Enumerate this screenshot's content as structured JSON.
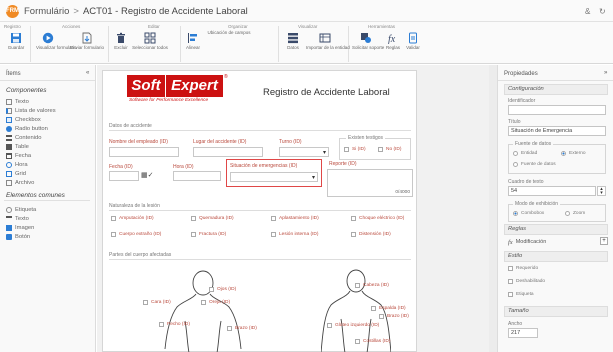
{
  "window": {
    "badge": "FRM",
    "breadcrumb_root": "Formulário",
    "breadcrumb_sep": ">",
    "breadcrumb_current": "ACT01 - Registro de Accidente Laboral",
    "flag": "&",
    "refresh_glyph": "↻"
  },
  "ribbon": {
    "groups": [
      "Registro",
      "Acciones",
      "Editar",
      "Organizar",
      "Visualizar",
      "Herramientas"
    ],
    "buttons": [
      {
        "label": "Guardar",
        "icon": "save-icon"
      },
      {
        "label": "Visualizar formulario",
        "icon": "preview-icon"
      },
      {
        "label": "Enviar formulario",
        "icon": "send-icon"
      },
      {
        "label": "Excluir",
        "icon": "delete-icon"
      },
      {
        "label": "Seleccionar todos",
        "icon": "select-all-icon"
      },
      {
        "label": "Alinear",
        "icon": "align-icon"
      },
      {
        "label": "Ubicación de campos",
        "icon": "field-location-icon"
      },
      {
        "label": "Datos",
        "icon": "data-icon"
      },
      {
        "label": "Importar de la entidad",
        "icon": "import-icon"
      },
      {
        "label": "Solicitar soporte",
        "icon": "support-icon"
      },
      {
        "label": "Reglas",
        "icon": "formula-icon"
      },
      {
        "label": "Validar",
        "icon": "validate-icon"
      }
    ]
  },
  "left_panel": {
    "title": "Ítems",
    "collapse_glyph": "«",
    "section_components": "Componentes",
    "components": [
      {
        "label": "Texto",
        "icon": "text-icon"
      },
      {
        "label": "Lista de valores",
        "icon": "list-icon"
      },
      {
        "label": "Checkbox",
        "icon": "checkbox-icon"
      },
      {
        "label": "Radio button",
        "icon": "radio-icon"
      },
      {
        "label": "Contenido",
        "icon": "content-icon"
      },
      {
        "label": "Table",
        "icon": "table-icon"
      },
      {
        "label": "Fecha",
        "icon": "date-icon"
      },
      {
        "label": "Hora",
        "icon": "clock-icon"
      },
      {
        "label": "Grid",
        "icon": "grid-icon"
      },
      {
        "label": "Archivo",
        "icon": "attachment-icon"
      }
    ],
    "section_elements": "Elementos comunes",
    "elements": [
      {
        "label": "Etiqueta",
        "icon": "label-icon"
      },
      {
        "label": "Texto",
        "icon": "textbox-icon"
      },
      {
        "label": "Imagen",
        "icon": "image-icon"
      },
      {
        "label": "Botón",
        "icon": "button-icon"
      }
    ]
  },
  "form": {
    "logo_soft": "Soft",
    "logo_expert": "Expert",
    "logo_reg": "®",
    "logo_tagline": "Software for Performance Excellence",
    "title": "Registro de Accidente Laboral",
    "section_employee": "Datos de accidente",
    "field_employee_name": "Nombre del empleado (ID)",
    "field_accident_place": "Lugar del accidente (ID)",
    "field_shift": "Turno (ID)",
    "group_witness": "Existen testigos",
    "witness_yes": "Si (ID)",
    "witness_no": "No (ID)",
    "field_date": "Fecha (ID)",
    "field_time": "Hora (ID)",
    "field_situation": "Situación de emergencias (ID)",
    "field_report": "Reporte (ID)",
    "char_counter": "0/4000",
    "section_nature": "Naturaleza de la lesión",
    "nature_options": [
      [
        "Amputación (ID)",
        "Quemadura (ID)",
        "Aplastamiento (ID)",
        "Choque eléctrico (ID)"
      ],
      [
        "Cuerpo extraño (ID)",
        "Fractura (ID)",
        "Lesión interna (ID)",
        "Distensión (ID)"
      ]
    ],
    "section_body": "Partes del cuerpo afectadas",
    "body_left_labels": [
      "Ojos (ID)",
      "Cara (ID)",
      "Oreja (ID)",
      "Pecho (ID)",
      "Brazo (ID)"
    ],
    "body_right_labels": [
      "Cabeza (ID)",
      "Espalda (ID)",
      "Brazo (ID)",
      "Glúteo izquierdo (ID)",
      "Costillas (ID)"
    ]
  },
  "right_panel": {
    "title": "Propiedades",
    "collapse_glyph": "»",
    "section_config": "Configuración",
    "identifier_label": "Identificador",
    "identifier_value": "",
    "name_label": "Título",
    "name_value": "Situación de Emergencia",
    "group_data_source": "Fuente de datos",
    "source_internal": "Entidad",
    "source_external": "Externo",
    "source_fixed": "Fuente de datos",
    "font_size_label": "Cuadro de texto",
    "font_size_value": "54",
    "group_edition": "Modo de exhibición",
    "edit_combo": "Combobox",
    "edit_zoom": "Zoom",
    "section_rules": "Reglas",
    "rules_item": "Modificación",
    "section_style": "Estilo",
    "style_required": "Requerido",
    "style_enabled": "Deshabilitado",
    "style_visible": "Etiqueta",
    "section_size": "Tamaño",
    "width_label": "Ancho",
    "width_value": "217"
  },
  "colors": {
    "accent_red": "#cc0000",
    "logo_red": "#cc1111",
    "field_label_red": "#b9483b",
    "selection_border": "#e04747",
    "ribbon_icon_blue": "#2c7dd4"
  }
}
